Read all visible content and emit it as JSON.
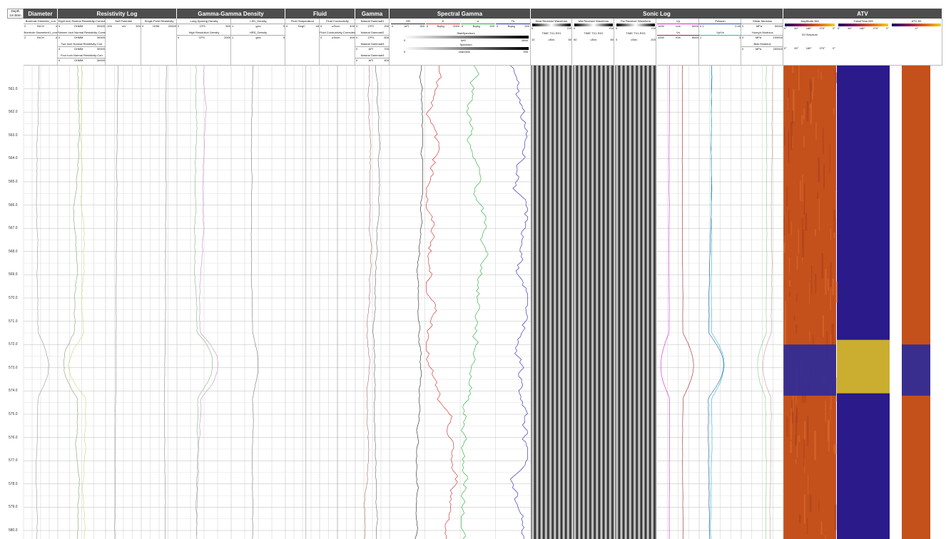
{
  "depth_header": {
    "title": "Depth",
    "scale": "1m:50m"
  },
  "groups": [
    {
      "key": "diameter",
      "label": "Diameter"
    },
    {
      "key": "resistivity",
      "label": "Resistivity Log"
    },
    {
      "key": "density",
      "label": "Gamma-Gamma Density"
    },
    {
      "key": "fluid",
      "label": "Fluid"
    },
    {
      "key": "gamma",
      "label": "Gamma"
    },
    {
      "key": "spectral",
      "label": "Spectral Gamma"
    },
    {
      "key": "sonic",
      "label": "Sonic Log"
    },
    {
      "key": "atv",
      "label": "ATV"
    }
  ],
  "tracks": {
    "diameter": [
      {
        "name": "Borehole Diameter_corr",
        "unit": "INCH",
        "min": "2",
        "max": "4"
      },
      {
        "name": "Borehole Diameter#1_corr",
        "unit": "INCH",
        "min": "2",
        "max": "4"
      }
    ],
    "resistivity_normal": [
      {
        "name": "Eight Inch Normal Resistivity-Correct",
        "unit": "OHMM",
        "min": "0",
        "max": "30000"
      },
      {
        "name": "Sixteen Inch Normal Resistivity-Correct",
        "unit": "OHMM",
        "min": "0",
        "max": "30000"
      },
      {
        "name": "Two Inch Normal Resistivity-Corr",
        "unit": "OHMM",
        "min": "0",
        "max": "30000"
      },
      {
        "name": "Four Inch Normal Resistivity-Corr",
        "unit": "OHMM",
        "min": "0",
        "max": "30000"
      }
    ],
    "self_potential": {
      "name": "Self Potential",
      "unit": "mV",
      "min": "-200",
      "max": "300"
    },
    "spr": {
      "name": "Single-Point Resistivity",
      "unit": "OHM",
      "min": "0",
      "max": "20000"
    },
    "density_left": [
      {
        "name": "Long Spacing Density",
        "unit": "CPS",
        "min": "0",
        "max": "500"
      },
      {
        "name": "High Resolution Density",
        "unit": "CPS",
        "min": "0",
        "max": "2000"
      }
    ],
    "density_right": [
      {
        "name": "LSD_Density",
        "unit": "g/cc",
        "min": "1",
        "max": "5"
      },
      {
        "name": "HRD_Density",
        "unit": "g/cc",
        "min": "1",
        "max": "5"
      }
    ],
    "fluid_temp": {
      "name": "Fluid Temperature",
      "unit": "DegC",
      "min": "0",
      "max": "40"
    },
    "fluid_cond": [
      {
        "name": "Fluid Conductivity",
        "unit": "uS/cm",
        "min": "0",
        "max": "400"
      },
      {
        "name": "Fluid Conductivity-Corrected",
        "unit": "uS/cm",
        "min": "0",
        "max": "400"
      }
    ],
    "gamma": [
      {
        "name": "Natural Gamma#1",
        "unit": "CPS",
        "min": "0",
        "max": "200"
      },
      {
        "name": "Natural Gamma#2",
        "unit": "CPS",
        "min": "0",
        "max": "600"
      },
      {
        "name": "Natural Gamma#3",
        "unit": "API",
        "min": "0",
        "max": "700"
      },
      {
        "name": "Natural Gamma#4",
        "unit": "API",
        "min": "0",
        "max": "400"
      }
    ],
    "spectral": [
      {
        "name": "GR",
        "unit": "API",
        "min": "0",
        "max": "300",
        "color": "#222222"
      },
      {
        "name": "K",
        "unit": "Bq/kg",
        "min": "0",
        "max": "2000",
        "color": "#cc2222"
      },
      {
        "name": "U",
        "unit": "Bq/kg",
        "min": "0",
        "max": "200",
        "color": "#22aa33"
      },
      {
        "name": "Th",
        "unit": "Bq/kg",
        "min": "0",
        "max": "200",
        "color": "#2222aa"
      }
    ],
    "spectral_images": [
      {
        "name": "StabSpectrum",
        "unit": "keV",
        "min": "0",
        "max": "2890"
      },
      {
        "name": "Spectrum",
        "unit": "channels",
        "min": "0",
        "max": "255"
      }
    ],
    "waveforms": [
      {
        "name": "Near Receiver Waveform",
        "min": "0",
        "max": "700",
        "time": "TIME TX1-RX1",
        "unit": "uSec",
        "tmin": "10",
        "tmax": "60"
      },
      {
        "name": "Mid Receiver Waveform",
        "min": "0",
        "max": "700",
        "time": "TIME TX1-RX2",
        "unit": "uSec",
        "tmin": "50",
        "tmax": "80"
      },
      {
        "name": "Far Receiver Waveform",
        "min": "0",
        "max": "700",
        "time": "TIME TX1-RX3",
        "unit": "uSec",
        "tmin": "0",
        "tmax": "200"
      }
    ],
    "velocity": [
      {
        "name": "Vp",
        "unit": "m/s",
        "min": "1000",
        "max": "8000",
        "color": "#dd22cc"
      },
      {
        "name": "Vs",
        "unit": "m/s",
        "min": "1000",
        "max": "8000",
        "color": "#992222"
      }
    ],
    "poisson": [
      {
        "name": "Poisson",
        "unit": "",
        "min": "0.1",
        "max": "0.45",
        "color": "#2255bb"
      },
      {
        "name": "Vp/Vs",
        "unit": "",
        "min": "1",
        "max": "3",
        "color": "#22bbbb"
      }
    ],
    "moduli": [
      {
        "name": "Shear Modulus",
        "unit": "MPa",
        "min": "0",
        "max": "50000"
      },
      {
        "name": "Young's Modulus",
        "unit": "MPa",
        "min": "0",
        "max": "100000"
      },
      {
        "name": "Bulk Modulus",
        "unit": "MPa",
        "min": "0",
        "max": "200000"
      }
    ],
    "atv": {
      "amplitude": {
        "name": "Amplitude-NM",
        "ticks": [
          "0°",
          "90°",
          "180°",
          "270°",
          "0°"
        ]
      },
      "traveltime": {
        "name": "TravelTime-NM",
        "ticks": [
          "0°",
          "90°",
          "180°",
          "270°",
          "0°"
        ]
      },
      "atv3d": {
        "name": "ATV 3D",
        "angle": "-0°"
      },
      "structure": {
        "name": "ISI Structure",
        "ticks": [
          "0°",
          "90°",
          "180°",
          "270°",
          "0°"
        ]
      }
    }
  },
  "depths": [
    "561.0",
    "562.0",
    "563.0",
    "564.0",
    "565.0",
    "566.0",
    "567.0",
    "568.0",
    "569.0",
    "570.0",
    "571.0",
    "572.0",
    "573.0",
    "574.0",
    "575.0",
    "576.0",
    "577.0",
    "578.0",
    "579.0",
    "580.0"
  ],
  "colors": {
    "header_band": "#4d4d4d",
    "grid": "#c8c8c8",
    "atv_orange": "#c8501e",
    "atv_blue": "#2a1a8a",
    "atv_yellow": "#f0d020"
  }
}
